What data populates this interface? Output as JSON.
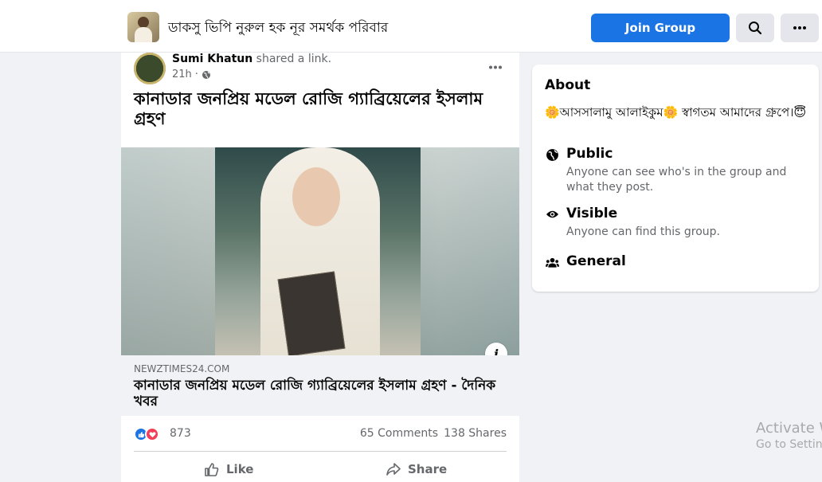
{
  "header": {
    "group_name": "ডাকসু ভিপি নুরুল হক নূর সমর্থক পরিবার",
    "join_label": "Join Group",
    "search_icon": "search-icon",
    "more_icon": "more-horizontal-icon",
    "accent": "#1b74e4"
  },
  "post": {
    "author": "Sumi Khatun",
    "action": "shared a link.",
    "time": "21h",
    "audience_icon": "globe-icon",
    "headline": "কানাডার জনপ্রিয় মডেল রোজি গ্যাব্রিয়েলের ইসলাম গ্রহণ",
    "link": {
      "domain": "NEWZTIMES24.COM",
      "title": "কানাডার জনপ্রিয় মডেল রোজি গ্যাব্রিয়েলের ইসলাম গ্রহণ - দৈনিক খবর",
      "info_label": "i"
    },
    "reactions": {
      "count": "873",
      "types": [
        "like",
        "love"
      ]
    },
    "comments": "65 Comments",
    "shares": "138 Shares",
    "actions": {
      "like": "Like",
      "share": "Share"
    }
  },
  "about": {
    "title": "About",
    "description": "🌼আসসালামু আলাইকুম🌼 স্বাগতম আমাদের গ্রুপে।😇",
    "items": [
      {
        "icon": "globe-icon",
        "title": "Public",
        "subtitle": "Anyone can see who's in the group and what they post."
      },
      {
        "icon": "eye-icon",
        "title": "Visible",
        "subtitle": "Anyone can find this group."
      },
      {
        "icon": "people-icon",
        "title": "General",
        "subtitle": ""
      }
    ]
  },
  "watermark": {
    "line1": "Activate W",
    "line2": "Go to Settin"
  }
}
